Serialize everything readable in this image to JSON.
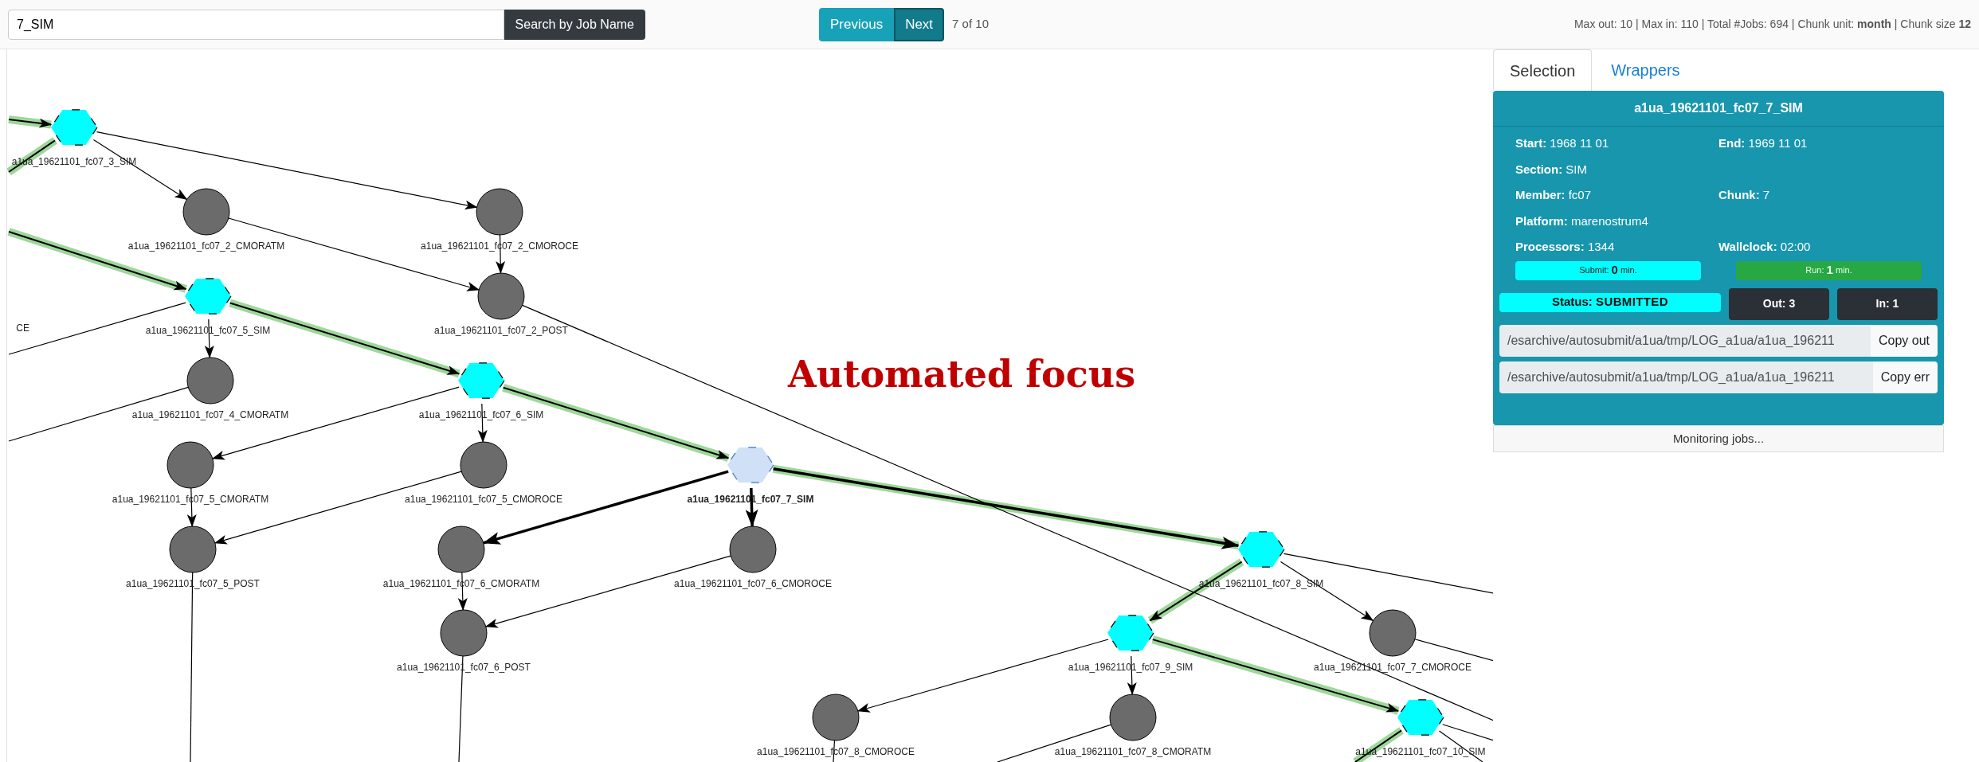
{
  "toolbar": {
    "search_value": "7_SIM",
    "search_button": "Search by Job Name",
    "previous_button": "Previous",
    "next_button": "Next",
    "position": "7 of 10",
    "summary": "Max out: 10 | Max in: 110 | Total #Jobs: 694 | Chunk unit: **month** | Chunk size **12**"
  },
  "graph": {
    "annotation": "Automated focus",
    "nodes": [
      {
        "label": "a1ua_19621101_fc07_3_SIM",
        "kind": "sim",
        "selected": false
      },
      {
        "label": "a1ua_19621101_fc07_2_CMORATM",
        "kind": "job",
        "selected": false
      },
      {
        "label": "a1ua_19621101_fc07_2_CMOROCE",
        "kind": "job",
        "selected": false
      },
      {
        "label": "CE",
        "kind": "label",
        "selected": false
      },
      {
        "label": "a1ua_19621101_fc07_5_SIM",
        "kind": "sim",
        "selected": false
      },
      {
        "label": "a1ua_19621101_fc07_2_POST",
        "kind": "job",
        "selected": false
      },
      {
        "label": "a1ua_19621101_fc07_4_CMORATM",
        "kind": "job",
        "selected": false
      },
      {
        "label": "a1ua_19621101_fc07_6_SIM",
        "kind": "sim",
        "selected": false
      },
      {
        "label": "a1ua_19621101_fc07_5_CMORATM",
        "kind": "job",
        "selected": false
      },
      {
        "label": "a1ua_19621101_fc07_5_CMOROCE",
        "kind": "job",
        "selected": false
      },
      {
        "label": "a1ua_19621101_fc07_7_SIM",
        "kind": "sim",
        "selected": true
      },
      {
        "label": "a1ua_19621101_fc07_5_POST",
        "kind": "job",
        "selected": false
      },
      {
        "label": "a1ua_19621101_fc07_6_CMORATM",
        "kind": "job",
        "selected": false
      },
      {
        "label": "a1ua_19621101_fc07_6_CMOROCE",
        "kind": "job",
        "selected": false
      },
      {
        "label": "a1ua_19621101_fc07_8_SIM",
        "kind": "sim",
        "selected": false
      },
      {
        "label": "a1ua_19621101_fc07_6_POST",
        "kind": "job",
        "selected": false
      },
      {
        "label": "a1ua_19621101_fc07_9_SIM",
        "kind": "sim",
        "selected": false
      },
      {
        "label": "a1ua_19621101_fc07_7_CMOROCE",
        "kind": "job",
        "selected": false
      },
      {
        "label": "a1ua_19621101_fc07_8_CMOROCE",
        "kind": "job",
        "selected": false
      },
      {
        "label": "a1ua_19621101_fc07_8_CMORATM",
        "kind": "job",
        "selected": false
      },
      {
        "label": "a1ua_19621101_fc07_10_SIM",
        "kind": "sim",
        "selected": false
      }
    ],
    "edges": [
      {
        "halo": true,
        "bold": false
      },
      {
        "halo": true,
        "bold": false
      },
      {
        "halo": false,
        "bold": false
      },
      {
        "halo": false,
        "bold": false
      },
      {
        "halo": false,
        "bold": false
      },
      {
        "halo": false,
        "bold": false
      },
      {
        "halo": true,
        "bold": false
      },
      {
        "halo": true,
        "bold": false
      },
      {
        "halo": true,
        "bold": false
      },
      {
        "halo": true,
        "bold": true
      },
      {
        "halo": true,
        "bold": false
      },
      {
        "halo": true,
        "bold": false
      },
      {
        "halo": true,
        "bold": false
      },
      {
        "halo": false,
        "bold": false
      },
      {
        "halo": false,
        "bold": false
      },
      {
        "halo": false,
        "bold": false
      },
      {
        "halo": false,
        "bold": false
      },
      {
        "halo": false,
        "bold": false
      },
      {
        "halo": false,
        "bold": false
      },
      {
        "halo": false,
        "bold": false
      },
      {
        "halo": false,
        "bold": false
      },
      {
        "halo": false,
        "bold": true
      },
      {
        "halo": false,
        "bold": true
      },
      {
        "halo": false,
        "bold": false
      },
      {
        "halo": false,
        "bold": false
      },
      {
        "halo": false,
        "bold": false
      },
      {
        "halo": false,
        "bold": false
      },
      {
        "halo": false,
        "bold": false
      },
      {
        "halo": false,
        "bold": false
      },
      {
        "halo": false,
        "bold": false
      },
      {
        "halo": false,
        "bold": false
      },
      {
        "halo": false,
        "bold": false
      },
      {
        "halo": false,
        "bold": false
      },
      {
        "halo": false,
        "bold": false
      },
      {
        "halo": false,
        "bold": false
      },
      {
        "halo": false,
        "bold": false
      }
    ]
  },
  "panel": {
    "tabs": [
      {
        "label": "Selection",
        "selected": true
      },
      {
        "label": "Wrappers",
        "selected": false
      }
    ],
    "title": "a1ua_19621101_fc07_7_SIM",
    "rows": [
      [
        {
          "label": "Start:",
          "value": "1968 11 01"
        },
        {
          "label": "End:",
          "value": "1969 11 01"
        }
      ],
      [
        {
          "label": "Section:",
          "value": "SIM"
        }
      ],
      [
        {
          "label": "Member:",
          "value": "fc07"
        },
        {
          "label": "Chunk:",
          "value": "7"
        }
      ],
      [
        {
          "label": "Platform:",
          "value": "marenostrum4"
        }
      ],
      [
        {
          "label": "Processors:",
          "value": "1344"
        },
        {
          "label": "Wallclock:",
          "value": "02:00"
        }
      ]
    ],
    "timers": [
      {
        "label": "Submit:",
        "value": "0",
        "unit": "min.",
        "color": "#00ffff"
      },
      {
        "label": "Run:",
        "value": "1",
        "unit": "min.",
        "color": "#28a745"
      }
    ],
    "status": {
      "label": "Status:",
      "value": "SUBMITTED",
      "color": "#00ffff"
    },
    "out_button": "Out: 3",
    "in_button": "In: 1",
    "logs": [
      {
        "path": "/esarchive/autosubmit/a1ua/tmp/LOG_a1ua/a1ua_196211",
        "button": "Copy out"
      },
      {
        "path": "/esarchive/autosubmit/a1ua/tmp/LOG_a1ua/a1ua_196211",
        "button": "Copy err"
      }
    ],
    "footer": "Monitoring jobs..."
  }
}
